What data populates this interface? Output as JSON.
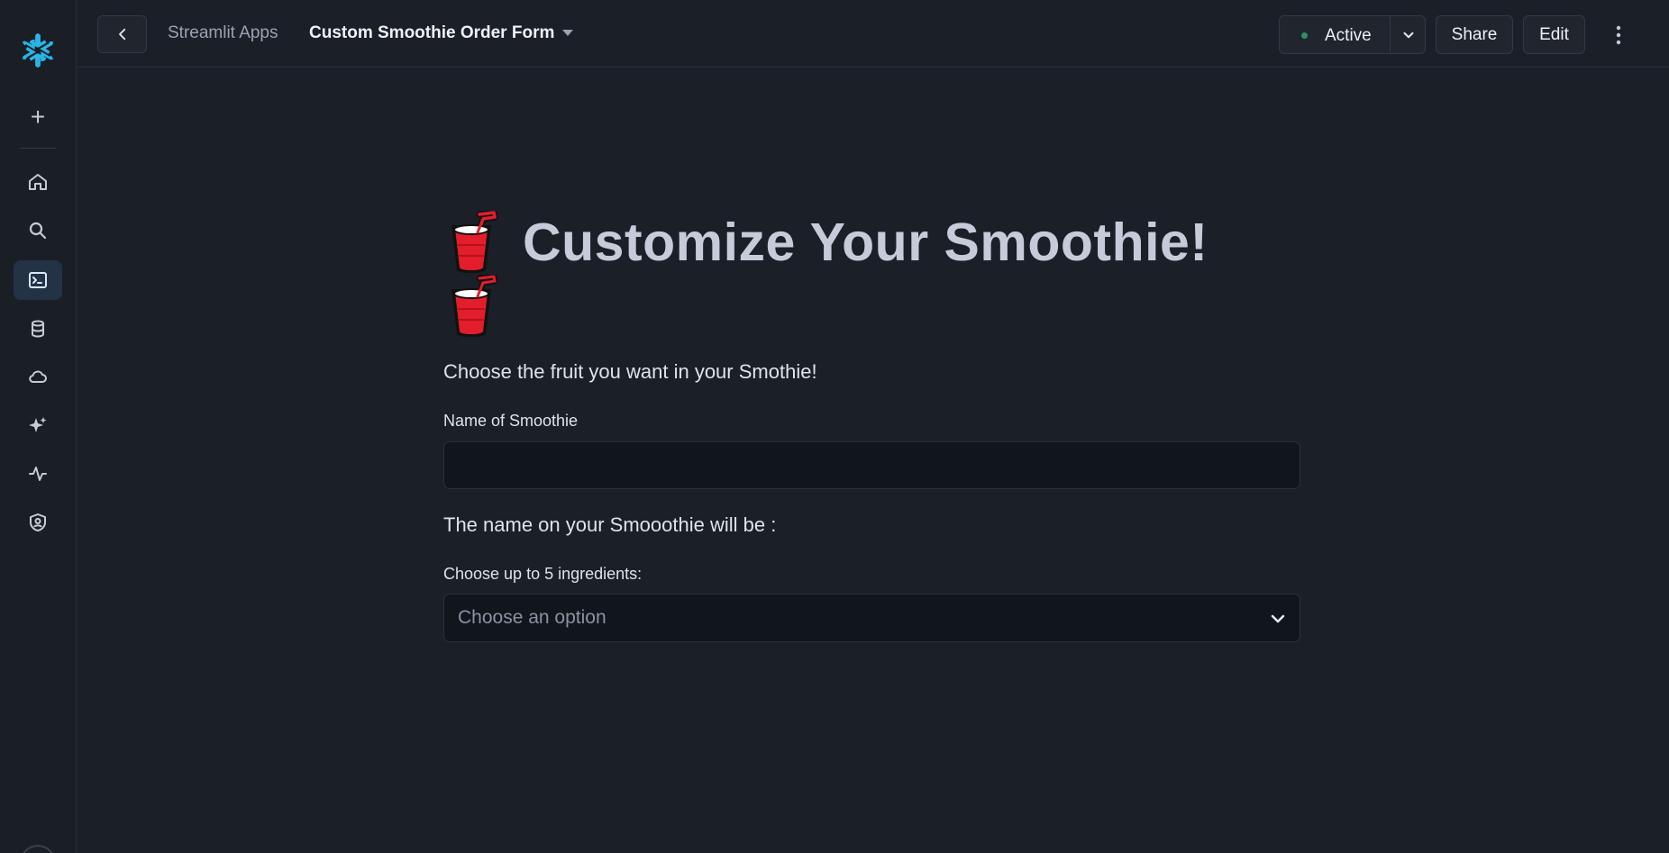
{
  "topbar": {
    "breadcrumb_parent": "Streamlit Apps",
    "app_title": "Custom Smoothie Order Form",
    "status_label": "Active",
    "status_color": "#2f8f6a",
    "share_label": "Share",
    "edit_label": "Edit"
  },
  "sidebar": {
    "icons": [
      "snowflake-logo-icon",
      "plus-icon",
      "home-icon",
      "search-icon",
      "terminal-icon",
      "database-icon",
      "cloud-icon",
      "sparkle-icon",
      "activity-icon",
      "shield-user-icon"
    ],
    "active_item": "terminal-icon"
  },
  "main": {
    "title_emoji": "🥤",
    "title": "Customize Your Smoothie!",
    "subtitle": "Choose the fruit you want in your Smothie!",
    "name_label": "Name of Smoothie",
    "name_value": "",
    "name_preview": "The name on your Smooothie will be :",
    "ingredients_label": "Choose up to 5 ingredients:",
    "ingredients_placeholder": "Choose an option"
  },
  "colors": {
    "background": "#1b1f27",
    "accent": "#29b5e8",
    "cup_red": "#e31d2b"
  }
}
